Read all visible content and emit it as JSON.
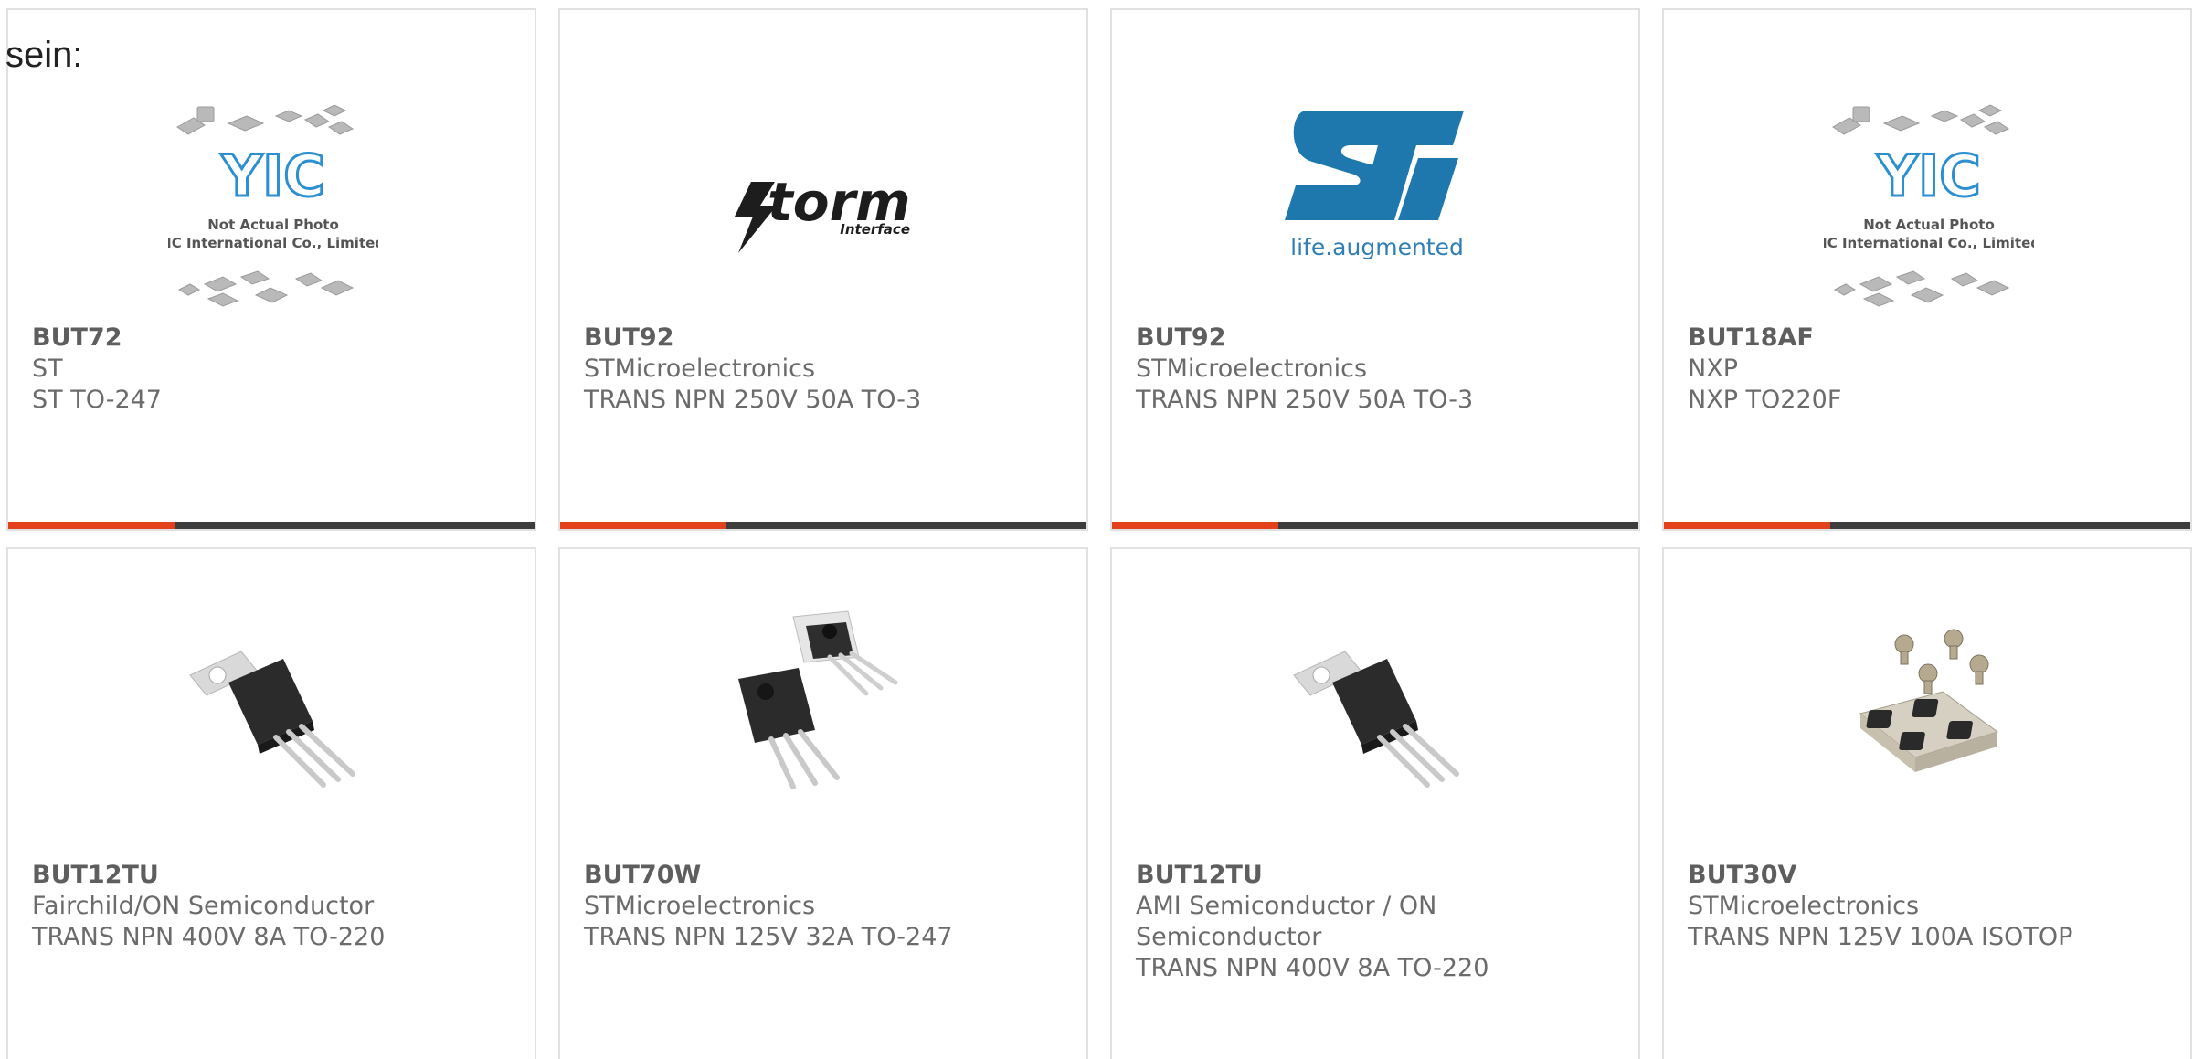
{
  "intro_text": "sein:",
  "logos": {
    "yic_mark": "YIC",
    "yic_line1": "Not Actual Photo",
    "yic_line2": "YIC International Co., Limited.",
    "storm_word": "torm",
    "storm_sub": "Interface",
    "st_sub": "life.augmented"
  },
  "products": [
    {
      "part": "BUT72",
      "maker": "ST",
      "desc": "ST TO-247",
      "image": "yic-placeholder-image"
    },
    {
      "part": "BUT92",
      "maker": "STMicroelectronics",
      "desc": "TRANS NPN 250V 50A TO-3",
      "image": "storm-interface-logo"
    },
    {
      "part": "BUT92",
      "maker": "STMicroelectronics",
      "desc": "TRANS NPN 250V 50A TO-3",
      "image": "st-life-augmented-logo"
    },
    {
      "part": "BUT18AF",
      "maker": "NXP",
      "desc": "NXP TO220F",
      "image": "yic-placeholder-image"
    },
    {
      "part": "BUT12TU",
      "maker": "Fairchild/ON Semiconductor",
      "desc": "TRANS NPN 400V 8A TO-220",
      "image": "to220-transistor-photo"
    },
    {
      "part": "BUT70W",
      "maker": "STMicroelectronics",
      "desc": "TRANS NPN 125V 32A TO-247",
      "image": "to247-transistor-photo"
    },
    {
      "part": "BUT12TU",
      "maker": "AMI Semiconductor / ON Semiconductor",
      "desc": "TRANS NPN 400V 8A TO-220",
      "image": "to220-transistor-photo"
    },
    {
      "part": "BUT30V",
      "maker": "STMicroelectronics",
      "desc": "TRANS NPN 125V 100A ISOTOP",
      "image": "isotop-module-photo"
    }
  ],
  "colors": {
    "accent_bar": "#e2411b",
    "bar": "#3d3d3d",
    "st_blue": "#2f7fb5",
    "yic_blue": "#2b8fd0"
  }
}
